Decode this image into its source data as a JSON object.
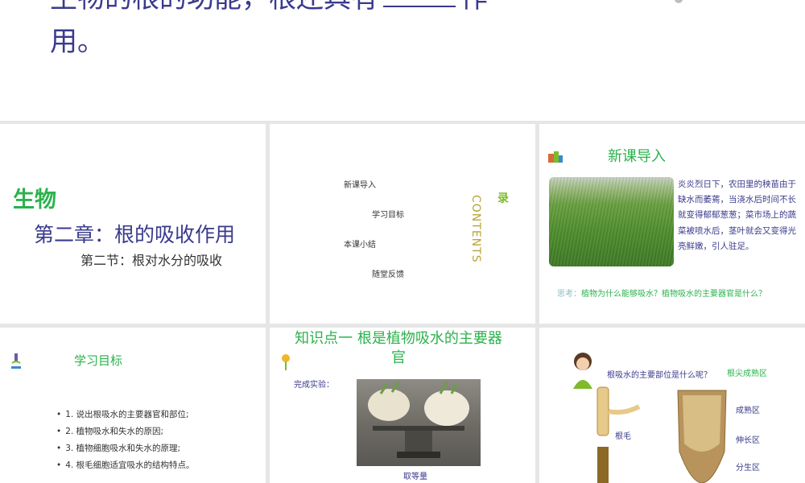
{
  "top": {
    "line1_pre": "生物的根的功能，根还具有",
    "line1_post": "作",
    "line2": "用。"
  },
  "slide1": {
    "subject": "生物",
    "chapter": "第二章：根的吸收作用",
    "section": "第二节：根对水分的吸收"
  },
  "slide2": {
    "items": [
      "新课导入",
      "学习目标",
      "本课小结",
      "随堂反馈"
    ],
    "lu": "录",
    "contents": "CONTENTS"
  },
  "slide3": {
    "title": "新课导入",
    "text": "炎炎烈日下，农田里的秧苗由于缺水而萎蔫，当浇水后时间不长就变得郁郁葱葱；菜市场上的蔬菜被喷水后，茎叶就会又变得光亮鲜嫩，引人驻足。",
    "think_label": "思考：",
    "think_question": "植物为什么能够吸水？植物吸水的主要器官是什么？"
  },
  "slide4": {
    "title": "学习目标",
    "goals": [
      "1. 说出根吸水的主要器官和部位;",
      "2. 植物吸水和失水的原因;",
      "3. 植物细胞吸水和失水的原理;",
      "4. 根毛细胞适宜吸水的结构特点。"
    ]
  },
  "slide5": {
    "title": "知识点一  根是植物吸水的主要器官",
    "label": "完成实验：",
    "caption": "取等量"
  },
  "slide6": {
    "question": "根吸水的主要部位是什么呢？",
    "answer": "根尖成熟区",
    "root_hair": "根毛",
    "zones": [
      "成熟区",
      "伸长区",
      "分生区"
    ]
  },
  "colors": {
    "green": "#2bb24c",
    "navy": "#3a3a8c",
    "gold": "#b8a436"
  }
}
